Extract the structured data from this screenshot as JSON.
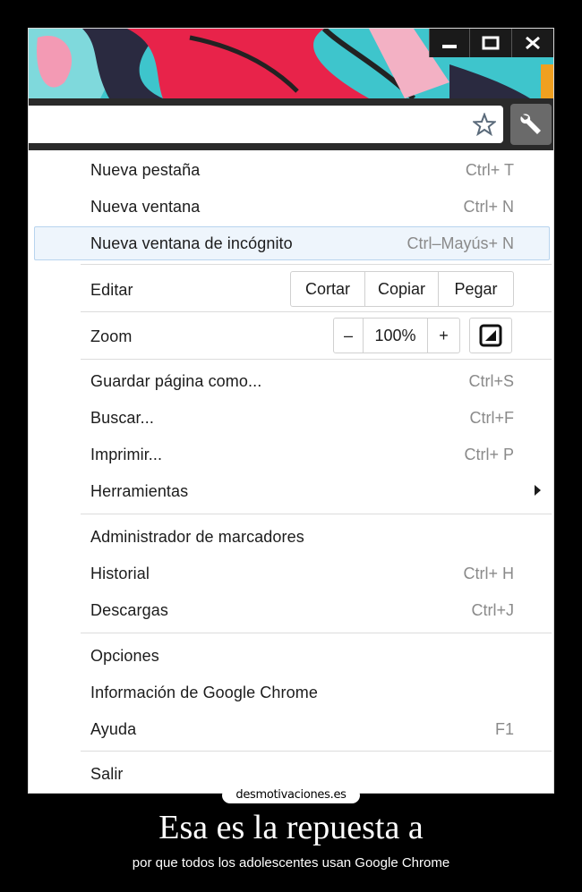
{
  "window": {
    "buttons": {
      "minimize": "minimize",
      "maximize": "maximize",
      "close": "close"
    }
  },
  "menu": {
    "new_tab": {
      "label": "Nueva pestaña",
      "shortcut": "Ctrl+ T"
    },
    "new_window": {
      "label": "Nueva ventana",
      "shortcut": "Ctrl+ N"
    },
    "incognito": {
      "label": "Nueva ventana de incógnito",
      "shortcut": "Ctrl–Mayús+ N"
    },
    "edit": {
      "label": "Editar",
      "cut": "Cortar",
      "copy": "Copiar",
      "paste": "Pegar"
    },
    "zoom": {
      "label": "Zoom",
      "minus": "–",
      "value": "100%",
      "plus": "+"
    },
    "save_page": {
      "label": "Guardar página como...",
      "shortcut": "Ctrl+S"
    },
    "find": {
      "label": "Buscar...",
      "shortcut": "Ctrl+F"
    },
    "print": {
      "label": "Imprimir...",
      "shortcut": "Ctrl+ P"
    },
    "tools": {
      "label": "Herramientas"
    },
    "bookmarks": {
      "label": "Administrador de marcadores"
    },
    "history": {
      "label": "Historial",
      "shortcut": "Ctrl+ H"
    },
    "downloads": {
      "label": "Descargas",
      "shortcut": "Ctrl+J"
    },
    "options": {
      "label": "Opciones"
    },
    "about": {
      "label": "Información de Google Chrome"
    },
    "help": {
      "label": "Ayuda",
      "shortcut": "F1"
    },
    "exit": {
      "label": "Salir"
    }
  },
  "poster": {
    "stamp": "desmotivaciones.es",
    "title": "Esa es la repuesta a",
    "subtitle": "por que todos los adolescentes usan Google Chrome"
  },
  "colors": {
    "highlight": "#eef5fc",
    "accent": "#b8d4ee",
    "theme_red": "#e8234a",
    "theme_cyan": "#3cc8cf"
  }
}
